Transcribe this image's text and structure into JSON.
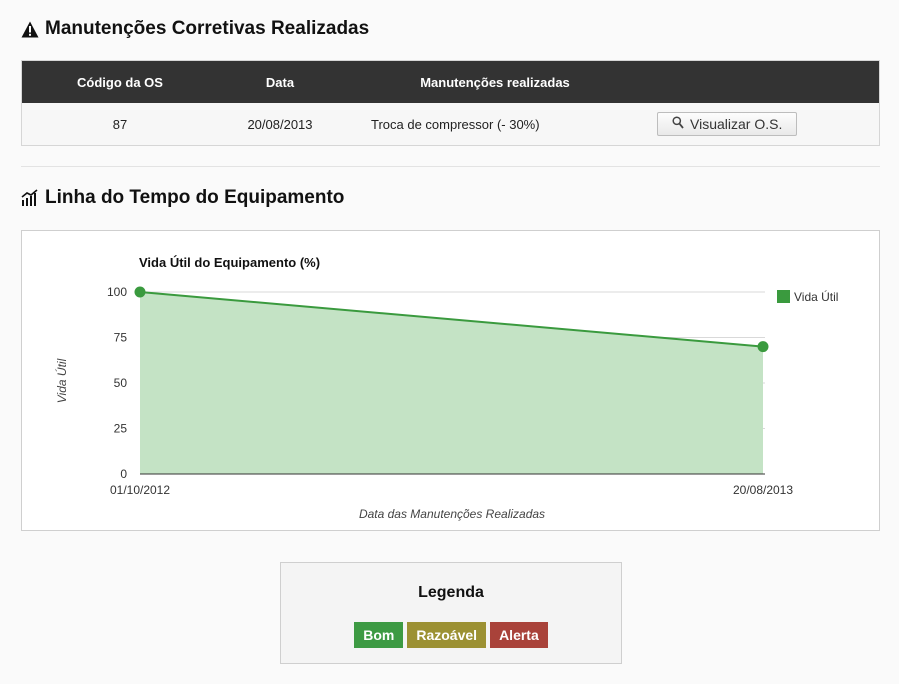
{
  "section1": {
    "title": "Manutenções Corretivas Realizadas",
    "icon": "warning-icon"
  },
  "table": {
    "headers": {
      "code": "Código da OS",
      "date": "Data",
      "maintenance": "Manutenções realizadas"
    },
    "rows": [
      {
        "code": "87",
        "date": "20/08/2013",
        "maintenance": "Troca de compressor (- 30%)",
        "button_label": "Visualizar O.S.",
        "button_icon": "search-icon"
      }
    ]
  },
  "section2": {
    "title": "Linha do Tempo do Equipamento",
    "icon": "chart-line-icon"
  },
  "chart_data": {
    "type": "area",
    "title": "Vida Útil do Equipamento (%)",
    "xlabel": "Data das Manutenções Realizadas",
    "ylabel": "Vida Útil",
    "x": [
      "01/10/2012",
      "20/08/2013"
    ],
    "series": [
      {
        "name": "Vida Útil",
        "values": [
          100,
          70
        ],
        "color": "#3a9a3e"
      }
    ],
    "ylim": [
      0,
      100
    ],
    "yticks": [
      "0",
      "25",
      "50",
      "75",
      "100"
    ],
    "grid": true,
    "legend_position": "right"
  },
  "legend": {
    "title": "Legenda",
    "items": [
      {
        "label": "Bom",
        "color": "#3d9a43"
      },
      {
        "label": "Razoável",
        "color": "#9c9133"
      },
      {
        "label": "Alerta",
        "color": "#a9423a"
      }
    ]
  }
}
